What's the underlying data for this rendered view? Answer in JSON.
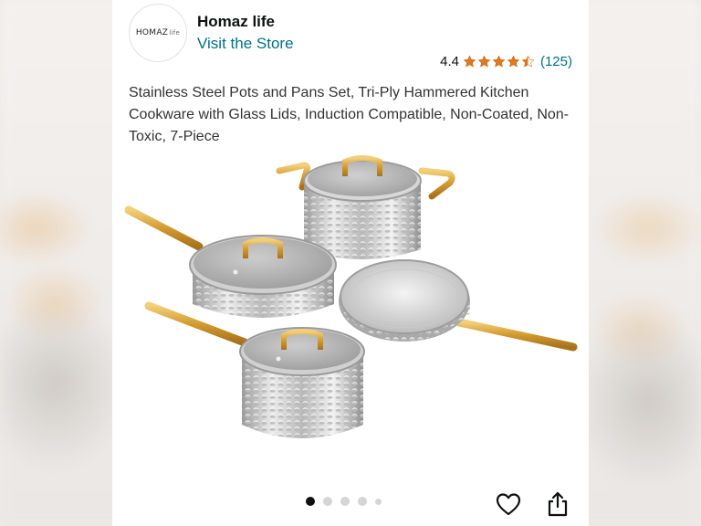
{
  "store": {
    "logo_text": "HOMAZ",
    "logo_text_small": "life",
    "name": "Homaz life",
    "visit_label": "Visit the Store"
  },
  "rating": {
    "value": "4.4",
    "stars": 4.4,
    "count": "(125)",
    "star_color": "#de7921"
  },
  "product": {
    "title": "Stainless Steel Pots and Pans Set, Tri-Ply Hammered Kitchen Cookware with Glass Lids, Induction Compatible, Non-Coated, Non-Toxic, 7-Piece",
    "image_alt": "cookware-set-photo"
  },
  "gallery": {
    "image_count": 5,
    "active_index": 0
  },
  "actions": {
    "like_icon": "heart-icon",
    "share_icon": "share-icon"
  },
  "colors": {
    "link": "#007185",
    "text": "#0f1111",
    "accent_gold": "#d4a13c"
  }
}
